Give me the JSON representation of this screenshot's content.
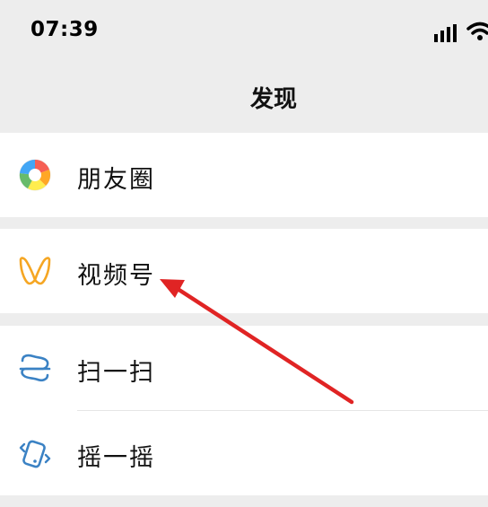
{
  "status_bar": {
    "time": "07:39"
  },
  "header": {
    "title": "发现"
  },
  "menu": {
    "moments": {
      "label": "朋友圈",
      "icon": "moments-aperture-icon"
    },
    "channels": {
      "label": "视频号",
      "icon": "channels-butterfly-icon"
    },
    "scan": {
      "label": "扫一扫",
      "icon": "scan-icon"
    },
    "shake": {
      "label": "摇一摇",
      "icon": "shake-icon"
    }
  },
  "annotation": {
    "icon": "red-arrow",
    "color": "#e02424",
    "points_to": "视频号"
  },
  "colors": {
    "background": "#ededed",
    "cell": "#ffffff",
    "channels_accent": "#f5a623",
    "scan_blue": "#3b82c4"
  }
}
